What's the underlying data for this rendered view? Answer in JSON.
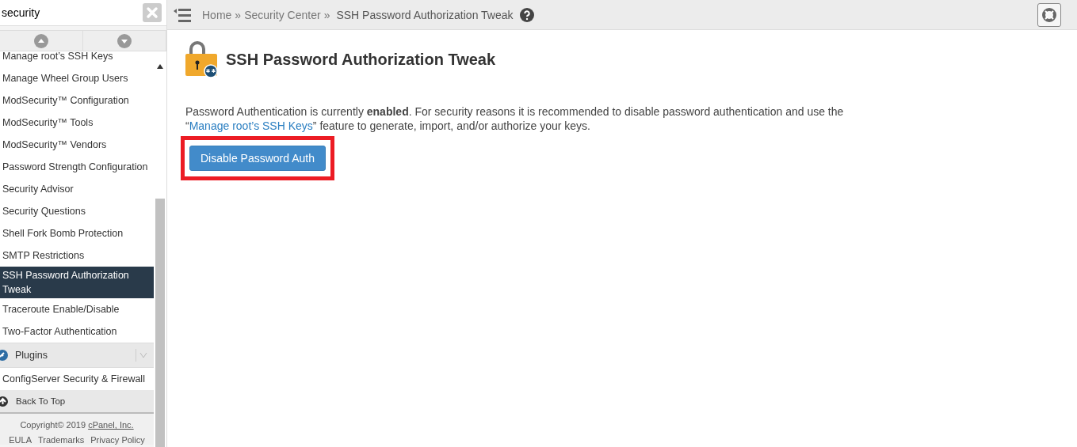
{
  "search": {
    "value": "security"
  },
  "sidebar": {
    "items": [
      {
        "label": "Manage root’s SSH Keys",
        "selected": false
      },
      {
        "label": "Manage Wheel Group Users",
        "selected": false
      },
      {
        "label": "ModSecurity™ Configuration",
        "selected": false
      },
      {
        "label": "ModSecurity™ Tools",
        "selected": false
      },
      {
        "label": "ModSecurity™ Vendors",
        "selected": false
      },
      {
        "label": "Password Strength Configuration",
        "selected": false
      },
      {
        "label": "Security Advisor",
        "selected": false
      },
      {
        "label": "Security Questions",
        "selected": false
      },
      {
        "label": "Shell Fork Bomb Protection",
        "selected": false
      },
      {
        "label": "SMTP Restrictions",
        "selected": false
      },
      {
        "label": "SSH Password Authorization Tweak",
        "selected": true
      },
      {
        "label": "Traceroute Enable/Disable",
        "selected": false
      },
      {
        "label": "Two-Factor Authentication",
        "selected": false
      }
    ],
    "section": {
      "label": "Plugins",
      "items": [
        {
          "label": "ConfigServer Security & Firewall",
          "selected": false
        }
      ]
    },
    "back_to_top": "Back To Top",
    "copyright": "Copyright© 2019 ",
    "company_link": "cPanel, Inc.",
    "footer_links": [
      "EULA",
      "Trademarks",
      "Privacy Policy"
    ]
  },
  "breadcrumb": [
    {
      "label": "Home"
    },
    {
      "label": "Security Center"
    },
    {
      "label": "SSH Password Authorization Tweak"
    }
  ],
  "breadcrumb_separator": "»",
  "page": {
    "title": "SSH Password Authorization Tweak",
    "message_before": "Password Authentication is currently **enabled**. For security reasons it is recommended to disable password authentication and use the “",
    "message_link": "Manage root’s SSH Keys",
    "message_after": "” feature to generate, import, and/or authorize your keys.",
    "button": {
      "label": "Disable Password Auth",
      "highlighted": true
    }
  }
}
